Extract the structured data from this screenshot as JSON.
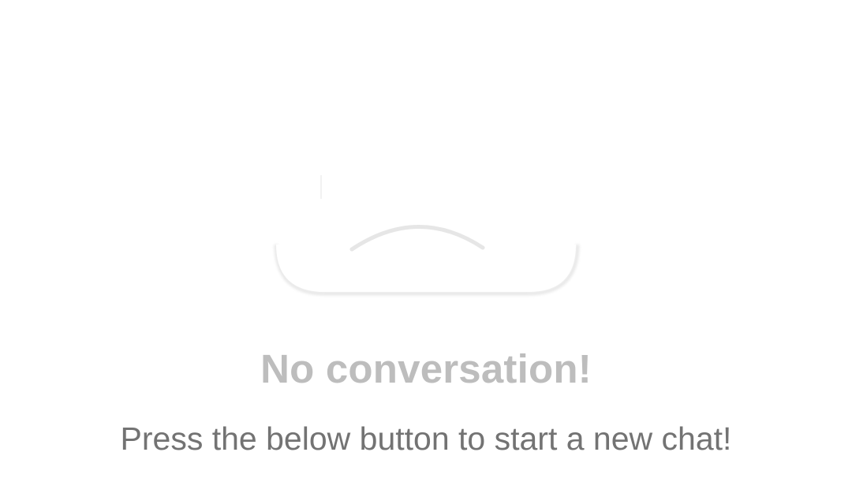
{
  "empty_state": {
    "illustration_icon": "empty-chat-cloud-icon",
    "title": "No conversation!",
    "subtitle": "Press the below button to start a new chat!"
  },
  "colors": {
    "background": "#ffffff",
    "title": "#bdbdbd",
    "subtitle": "#737373",
    "illustration_shadow": "#e6e6e6"
  }
}
